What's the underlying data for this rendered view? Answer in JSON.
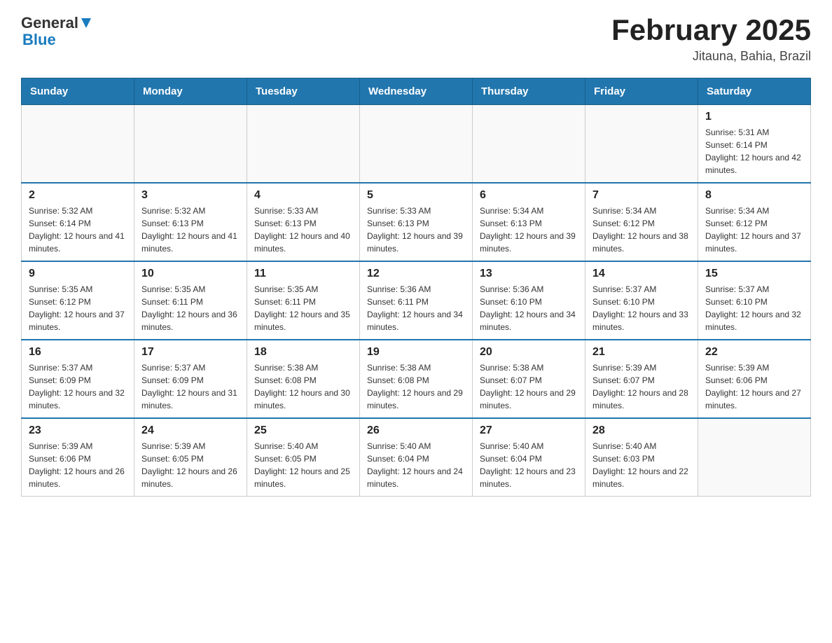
{
  "header": {
    "logo_general": "General",
    "logo_blue": "Blue",
    "title": "February 2025",
    "subtitle": "Jitauna, Bahia, Brazil"
  },
  "weekdays": [
    "Sunday",
    "Monday",
    "Tuesday",
    "Wednesday",
    "Thursday",
    "Friday",
    "Saturday"
  ],
  "weeks": [
    [
      {
        "day": "",
        "info": ""
      },
      {
        "day": "",
        "info": ""
      },
      {
        "day": "",
        "info": ""
      },
      {
        "day": "",
        "info": ""
      },
      {
        "day": "",
        "info": ""
      },
      {
        "day": "",
        "info": ""
      },
      {
        "day": "1",
        "info": "Sunrise: 5:31 AM\nSunset: 6:14 PM\nDaylight: 12 hours and 42 minutes."
      }
    ],
    [
      {
        "day": "2",
        "info": "Sunrise: 5:32 AM\nSunset: 6:14 PM\nDaylight: 12 hours and 41 minutes."
      },
      {
        "day": "3",
        "info": "Sunrise: 5:32 AM\nSunset: 6:13 PM\nDaylight: 12 hours and 41 minutes."
      },
      {
        "day": "4",
        "info": "Sunrise: 5:33 AM\nSunset: 6:13 PM\nDaylight: 12 hours and 40 minutes."
      },
      {
        "day": "5",
        "info": "Sunrise: 5:33 AM\nSunset: 6:13 PM\nDaylight: 12 hours and 39 minutes."
      },
      {
        "day": "6",
        "info": "Sunrise: 5:34 AM\nSunset: 6:13 PM\nDaylight: 12 hours and 39 minutes."
      },
      {
        "day": "7",
        "info": "Sunrise: 5:34 AM\nSunset: 6:12 PM\nDaylight: 12 hours and 38 minutes."
      },
      {
        "day": "8",
        "info": "Sunrise: 5:34 AM\nSunset: 6:12 PM\nDaylight: 12 hours and 37 minutes."
      }
    ],
    [
      {
        "day": "9",
        "info": "Sunrise: 5:35 AM\nSunset: 6:12 PM\nDaylight: 12 hours and 37 minutes."
      },
      {
        "day": "10",
        "info": "Sunrise: 5:35 AM\nSunset: 6:11 PM\nDaylight: 12 hours and 36 minutes."
      },
      {
        "day": "11",
        "info": "Sunrise: 5:35 AM\nSunset: 6:11 PM\nDaylight: 12 hours and 35 minutes."
      },
      {
        "day": "12",
        "info": "Sunrise: 5:36 AM\nSunset: 6:11 PM\nDaylight: 12 hours and 34 minutes."
      },
      {
        "day": "13",
        "info": "Sunrise: 5:36 AM\nSunset: 6:10 PM\nDaylight: 12 hours and 34 minutes."
      },
      {
        "day": "14",
        "info": "Sunrise: 5:37 AM\nSunset: 6:10 PM\nDaylight: 12 hours and 33 minutes."
      },
      {
        "day": "15",
        "info": "Sunrise: 5:37 AM\nSunset: 6:10 PM\nDaylight: 12 hours and 32 minutes."
      }
    ],
    [
      {
        "day": "16",
        "info": "Sunrise: 5:37 AM\nSunset: 6:09 PM\nDaylight: 12 hours and 32 minutes."
      },
      {
        "day": "17",
        "info": "Sunrise: 5:37 AM\nSunset: 6:09 PM\nDaylight: 12 hours and 31 minutes."
      },
      {
        "day": "18",
        "info": "Sunrise: 5:38 AM\nSunset: 6:08 PM\nDaylight: 12 hours and 30 minutes."
      },
      {
        "day": "19",
        "info": "Sunrise: 5:38 AM\nSunset: 6:08 PM\nDaylight: 12 hours and 29 minutes."
      },
      {
        "day": "20",
        "info": "Sunrise: 5:38 AM\nSunset: 6:07 PM\nDaylight: 12 hours and 29 minutes."
      },
      {
        "day": "21",
        "info": "Sunrise: 5:39 AM\nSunset: 6:07 PM\nDaylight: 12 hours and 28 minutes."
      },
      {
        "day": "22",
        "info": "Sunrise: 5:39 AM\nSunset: 6:06 PM\nDaylight: 12 hours and 27 minutes."
      }
    ],
    [
      {
        "day": "23",
        "info": "Sunrise: 5:39 AM\nSunset: 6:06 PM\nDaylight: 12 hours and 26 minutes."
      },
      {
        "day": "24",
        "info": "Sunrise: 5:39 AM\nSunset: 6:05 PM\nDaylight: 12 hours and 26 minutes."
      },
      {
        "day": "25",
        "info": "Sunrise: 5:40 AM\nSunset: 6:05 PM\nDaylight: 12 hours and 25 minutes."
      },
      {
        "day": "26",
        "info": "Sunrise: 5:40 AM\nSunset: 6:04 PM\nDaylight: 12 hours and 24 minutes."
      },
      {
        "day": "27",
        "info": "Sunrise: 5:40 AM\nSunset: 6:04 PM\nDaylight: 12 hours and 23 minutes."
      },
      {
        "day": "28",
        "info": "Sunrise: 5:40 AM\nSunset: 6:03 PM\nDaylight: 12 hours and 22 minutes."
      },
      {
        "day": "",
        "info": ""
      }
    ]
  ]
}
